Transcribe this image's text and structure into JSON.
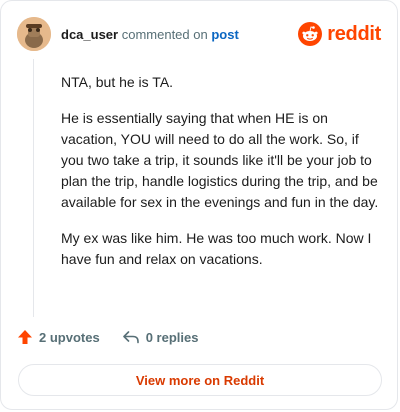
{
  "header": {
    "username": "dca_user",
    "action_text": "commented on",
    "post_link": "post",
    "brand": "reddit"
  },
  "comment": {
    "paragraphs": [
      "NTA, but he is TA.",
      "He is essentially saying that when HE is on vacation, YOU will need to do all the work. So, if you two take a trip, it sounds like it'll be your job to plan the trip, handle logistics during the trip, and be available for sex in the evenings and fun in the day.",
      "My ex was like him. He was too much work. Now I have fun and relax on vacations."
    ]
  },
  "actions": {
    "upvotes": "2 upvotes",
    "replies": "0 replies"
  },
  "footer": {
    "view_more": "View more on Reddit"
  },
  "colors": {
    "accent": "#ff4500",
    "link": "#0a66c2",
    "view_more": "#d93a00"
  }
}
